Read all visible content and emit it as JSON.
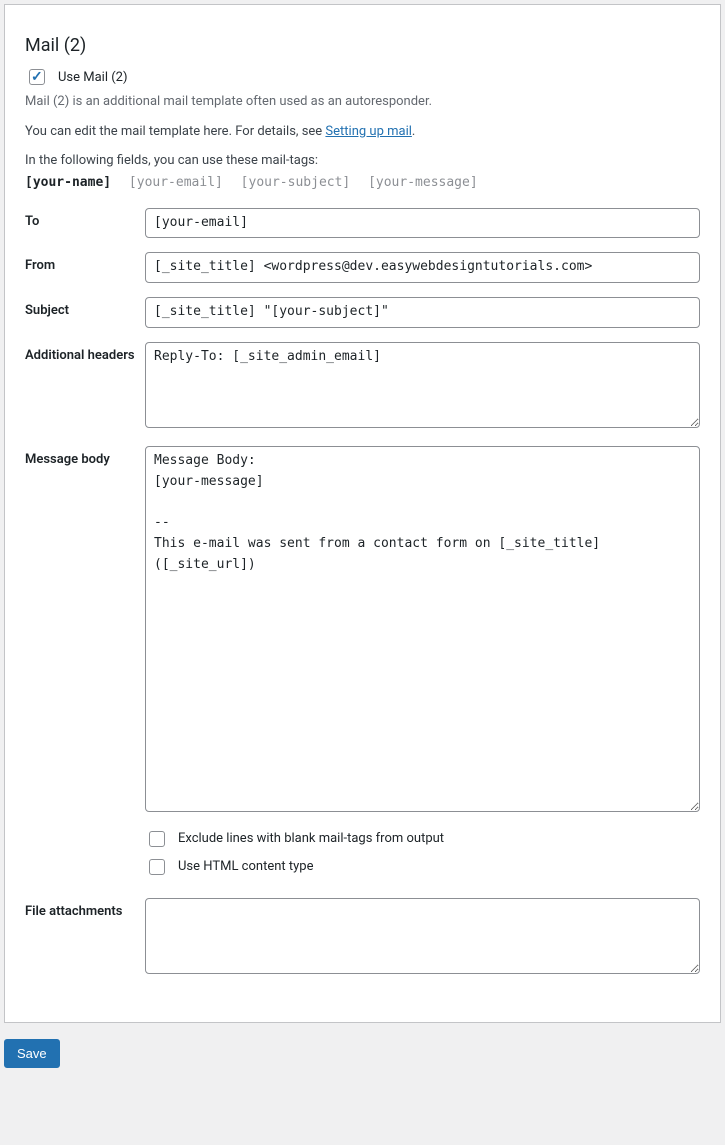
{
  "section": {
    "title": "Mail (2)",
    "use_mail2_label": "Use Mail (2)",
    "use_mail2_checked": true,
    "description": "Mail (2) is an additional mail template often used as an autoresponder.",
    "edit_hint_pre": "You can edit the mail template here. For details, see ",
    "edit_hint_link": "Setting up mail",
    "edit_hint_post": ".",
    "tags_hint": "In the following fields, you can use these mail-tags:",
    "tags": {
      "t1": "[your-name]",
      "t2": "[your-email]",
      "t3": "[your-subject]",
      "t4": "[your-message]"
    }
  },
  "fields": {
    "to": {
      "label": "To",
      "value": "[your-email]"
    },
    "from": {
      "label": "From",
      "value": "[_site_title] <wordpress@dev.easywebdesigntutorials.com>"
    },
    "subject": {
      "label": "Subject",
      "value": "[_site_title] \"[your-subject]\""
    },
    "headers": {
      "label": "Additional headers",
      "value": "Reply-To: [_site_admin_email]"
    },
    "body": {
      "label": "Message body",
      "value": "Message Body:\n[your-message]\n\n-- \nThis e-mail was sent from a contact form on [_site_title] ([_site_url])"
    },
    "exclude_blank": {
      "label": "Exclude lines with blank mail-tags from output",
      "checked": false
    },
    "use_html": {
      "label": "Use HTML content type",
      "checked": false
    },
    "attachments": {
      "label": "File attachments",
      "value": ""
    }
  },
  "actions": {
    "save": "Save"
  }
}
